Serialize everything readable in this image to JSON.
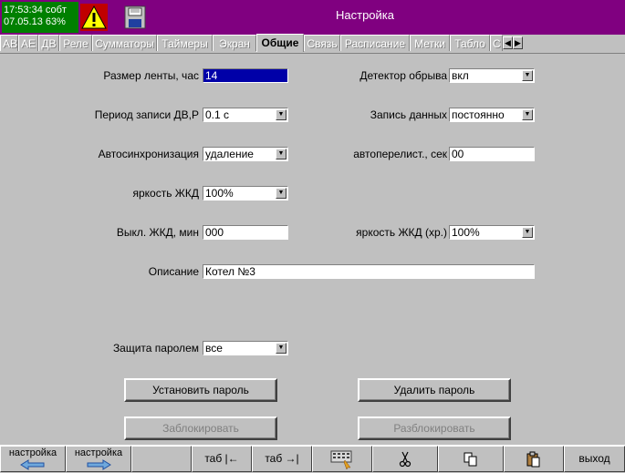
{
  "status": {
    "time": "17:53:34",
    "status_word": "собт",
    "date": "07.05.13",
    "battery": "63%"
  },
  "window": {
    "title": "Настройка"
  },
  "tabs": [
    "АВ",
    "АЕ",
    "ДВ",
    "Реле",
    "Сумматоры",
    "Таймеры",
    "Экран",
    "Общие",
    "Связь",
    "Расписание",
    "Метки",
    "Табло",
    "С"
  ],
  "active_tab": "Общие",
  "form": {
    "tape_size": {
      "label": "Размер ленты, час",
      "value": "14"
    },
    "break_detector": {
      "label": "Детектор обрыва",
      "value": "вкл"
    },
    "record_period": {
      "label": "Период записи ДВ,Р",
      "value": "0.1 с"
    },
    "data_record": {
      "label": "Запись данных",
      "value": "постоянно"
    },
    "autosync": {
      "label": "Автосинхронизация",
      "value": "удаление"
    },
    "autoscroll": {
      "label": "автоперелист., сек",
      "value": "00"
    },
    "lcd_brightness": {
      "label": "яркость ЖКД",
      "value": "100%"
    },
    "lcd_off": {
      "label": "Выкл. ЖКД, мин",
      "value": "000"
    },
    "lcd_brightness_standby": {
      "label": "яркость ЖКД (хр.)",
      "value": "100%"
    },
    "description": {
      "label": "Описание",
      "value": "Котел №3"
    },
    "password_protect": {
      "label": "Защита паролем",
      "value": "все"
    }
  },
  "buttons": {
    "set_password": "Установить пароль",
    "delete_password": "Удалить пароль",
    "lock": "Заблокировать",
    "unlock": "Разблокировать"
  },
  "toolbar": {
    "prev_label": "настройка",
    "next_label": "настройка",
    "tab_back": "таб |←",
    "tab_forward": "таб →|",
    "exit": "выход"
  },
  "colors": {
    "titlebar": "#800080",
    "status_bg": "#008000",
    "selection": "#0000a8",
    "face": "#c0c0c0"
  }
}
